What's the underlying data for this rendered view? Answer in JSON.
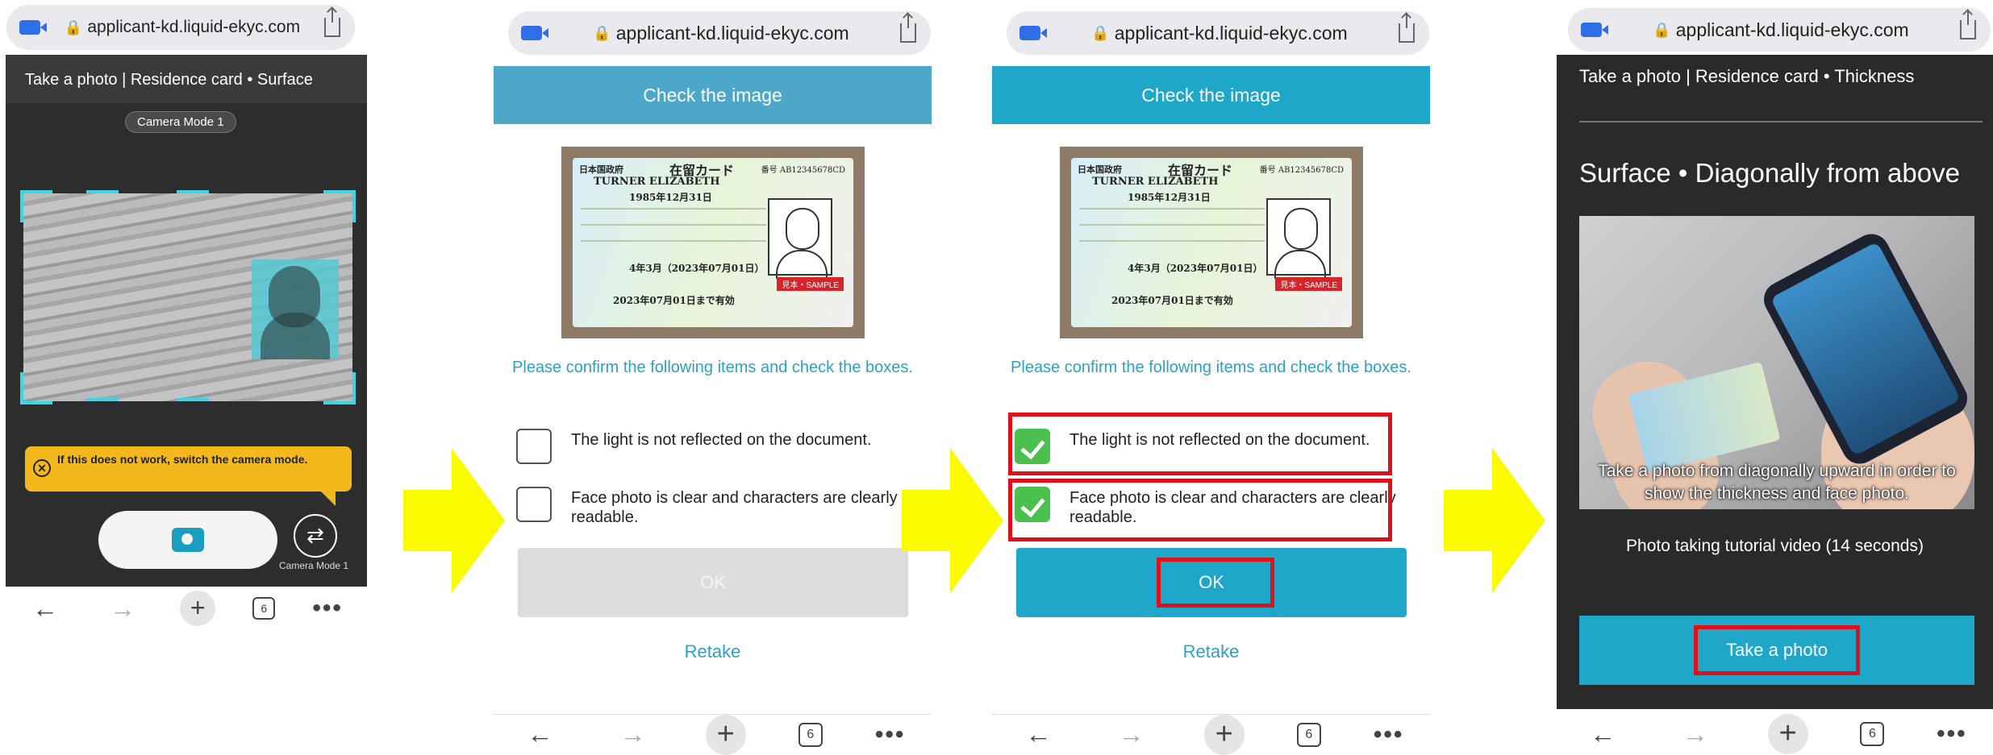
{
  "colors": {
    "accent": "#1ea7c8",
    "header_disabled": "#4ca7c8",
    "ok_disabled": "#dddddd",
    "check_green": "#4cc04e",
    "highlight_red": "#e0101a",
    "arrow_yellow": "#fafa00",
    "warning": "#f3b81b"
  },
  "browser": {
    "url": "applicant-kd.liquid-ekyc.com",
    "tab_count": "6"
  },
  "screen1": {
    "title": "Take a photo | Residence card • Surface",
    "camera_mode_badge": "Camera Mode 1",
    "warning_text": "If this does not work, switch the camera mode.",
    "switch_label": "Camera Mode 1"
  },
  "check": {
    "header": "Check the image",
    "confirm_text": "Please confirm the following items and check the boxes.",
    "items": [
      "The light is not reflected on the document.",
      "Face photo is clear and characters are clearly readable."
    ],
    "ok_label": "OK",
    "retake_label": "Retake"
  },
  "card": {
    "issuer": "日本国政府",
    "title": "在留カード",
    "number": "番号 AB12345678CD",
    "name": "TURNER ELIZABETH",
    "birth": "1985年12月31日",
    "period": "4年3月（2023年07月01日）",
    "expiry": "2023年07月01日まで有効",
    "sample": "見本・SAMPLE"
  },
  "screen4": {
    "title": "Take a photo | Residence card • Thickness",
    "heading": "Surface • Diagonally from above",
    "caption": "Take a photo from diagonally upward in order to show the thickness and face photo.",
    "video_label": "Photo taking tutorial video (14 seconds)",
    "take_button": "Take a photo"
  }
}
